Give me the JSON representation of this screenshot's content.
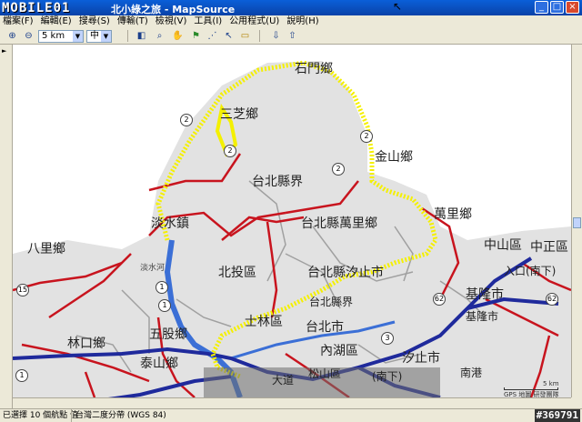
{
  "window": {
    "logo": "MOBILE01",
    "title": "北小綠之旅 - MapSource"
  },
  "menu": [
    {
      "label": "檔案(F)"
    },
    {
      "label": "編輯(E)"
    },
    {
      "label": "搜尋(S)"
    },
    {
      "label": "傳輸(T)"
    },
    {
      "label": "檢視(V)"
    },
    {
      "label": "工具(I)"
    },
    {
      "label": "公用程式(U)"
    },
    {
      "label": "說明(H)"
    }
  ],
  "toolbar": {
    "zoom_value": "5 km",
    "detail_value": "中"
  },
  "map_labels": {
    "shimen": "石門鄉",
    "sanzhi": "三芝鄉",
    "jinshan": "金山鄉",
    "wanli": "萬里鄉",
    "tamsui": "淡水鎮",
    "bali": "八里鄉",
    "beitou": "北投區",
    "taipei_county_border_1": "台北縣界",
    "taipei_county_wanli": "台北縣萬里鄉",
    "taipei_county_xizhi": "台北縣汐止市",
    "taipei_county_border_2": "台北縣界",
    "shilin": "士林區",
    "taipei_city": "台北市",
    "neihu": "內湖區",
    "wugu": "五股鄉",
    "linkou": "林口鄉",
    "taishan": "泰山鄉",
    "zhongshan": "中山區",
    "zhongzheng": "中正區",
    "keelung": "基隆市",
    "tamsui_river": "淡水河",
    "keelung_small": "基隆市",
    "nangang": "南港",
    "xizhi_city": "汐止市",
    "intersection": "入口(南下)",
    "intersection2": "(南下)",
    "daoyu": "大道",
    "songshan": "松山區"
  },
  "route_shields": [
    "2",
    "2",
    "2",
    "2",
    "1",
    "15",
    "62",
    "62",
    "1",
    "3",
    "1"
  ],
  "scale": {
    "label": "5 km",
    "credit": "GPS 地圖 研發團隊"
  },
  "status": {
    "selected": "已選擇 10 個航點 值",
    "datum": "台灣二度分帶 (WGS 84)"
  },
  "watermark": "#369791",
  "colors": {
    "route_highlight": "#f4f000",
    "primary_road": "#c8141e",
    "highway": "#1f2a9c",
    "secondary_road": "#a0a0a0",
    "land": "#e2e2e2",
    "sea": "#ffffff",
    "river": "#3b6fd6"
  }
}
